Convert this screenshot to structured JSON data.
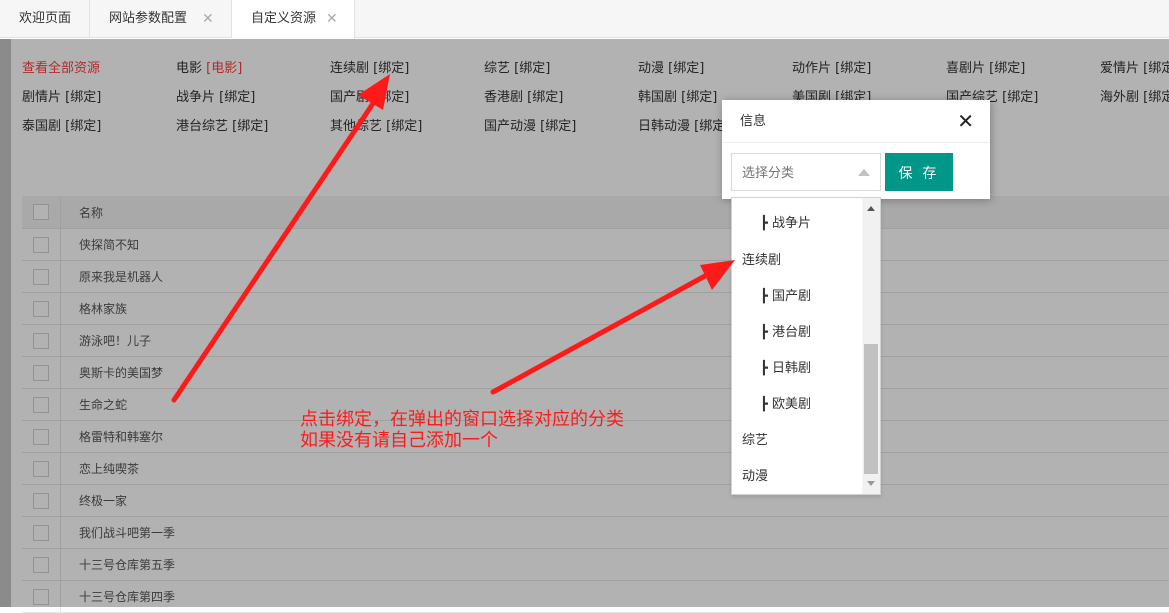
{
  "tabs": [
    {
      "label": "欢迎页面",
      "closable": false
    },
    {
      "label": "网站参数配置",
      "closable": true
    },
    {
      "label": "自定义资源",
      "closable": true,
      "active": true
    }
  ],
  "categories": {
    "view_all": "查看全部资源",
    "items": [
      {
        "name": "电影",
        "tag": "[电影]",
        "tag_highlight": true
      },
      {
        "name": "连续剧",
        "tag": "[绑定]"
      },
      {
        "name": "综艺",
        "tag": "[绑定]"
      },
      {
        "name": "动漫",
        "tag": "[绑定]"
      },
      {
        "name": "动作片",
        "tag": "[绑定]"
      },
      {
        "name": "喜剧片",
        "tag": "[绑定]"
      },
      {
        "name": "爱情片",
        "tag": "[绑定]"
      },
      {
        "name": "剧情片",
        "tag": "[绑定]"
      },
      {
        "name": "战争片",
        "tag": "[绑定]"
      },
      {
        "name": "国产剧",
        "tag": "[绑定]"
      },
      {
        "name": "香港剧",
        "tag": "[绑定]"
      },
      {
        "name": "韩国剧",
        "tag": "[绑定]"
      },
      {
        "name": "美国剧",
        "tag": "[绑定]"
      },
      {
        "name": "国产综艺",
        "tag": "[绑定]"
      },
      {
        "name": "海外剧",
        "tag": "[绑定]"
      },
      {
        "name": "泰国剧",
        "tag": "[绑定]"
      },
      {
        "name": "港台综艺",
        "tag": "[绑定]"
      },
      {
        "name": "其他综艺",
        "tag": "[绑定]"
      },
      {
        "name": "国产动漫",
        "tag": "[绑定]"
      },
      {
        "name": "日韩动漫",
        "tag": "[绑定]"
      }
    ]
  },
  "table": {
    "header": "名称",
    "rows": [
      "侠探简不知",
      "原来我是机器人",
      "格林家族",
      "游泳吧！儿子",
      "奥斯卡的美国梦",
      "生命之蛇",
      "格雷特和韩塞尔",
      "恋上纯喫茶",
      "终极一家",
      "我们战斗吧第一季",
      "十三号仓库第五季",
      "十三号仓库第四季"
    ]
  },
  "dialog": {
    "title": "信息",
    "select_placeholder": "选择分类",
    "save_label": "保 存"
  },
  "dropdown": {
    "options": [
      {
        "label": "┣ 战争片",
        "sub": true
      },
      {
        "label": "连续剧",
        "sub": false
      },
      {
        "label": "┣ 国产剧",
        "sub": true
      },
      {
        "label": "┣ 港台剧",
        "sub": true
      },
      {
        "label": "┣ 日韩剧",
        "sub": true
      },
      {
        "label": "┣ 欧美剧",
        "sub": true
      },
      {
        "label": "综艺",
        "sub": false
      },
      {
        "label": "动漫",
        "sub": false
      }
    ]
  },
  "annotation": {
    "line1": "点击绑定，在弹出的窗口选择对应的分类",
    "line2": "如果没有请自己添加一个",
    "color": "#ff1a1a"
  },
  "colors": {
    "accent": "#009688",
    "highlight": "#ff3b3b"
  }
}
